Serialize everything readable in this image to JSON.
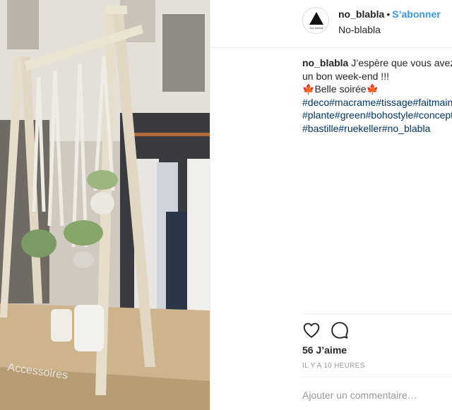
{
  "post": {
    "image_alt_name": "shop-window-photo"
  },
  "header": {
    "username": "no_blabla",
    "separator": "•",
    "follow_label": "S’abonner",
    "location": "No-blabla",
    "avatar_text": "No-blabla"
  },
  "caption": {
    "username": "no_blabla",
    "line1_text": "J’espère que vous avez",
    "line2_text": "un bon week-end !!!",
    "line3_text": "Belle soirée",
    "leaf_emoji": "🍁",
    "tags_line1": "#deco#macrame#tissage#faitmain",
    "tags_line2": "#plante#green#bohostyle#concept",
    "tags_line3": "#bastille#ruekeller#no_blabla"
  },
  "actions": {
    "like_icon": "heart-icon",
    "comment_icon": "comment-icon"
  },
  "likes_label": "56 J’aime",
  "timestamp": "IL Y A 10 HEURES",
  "comment_placeholder": "Ajouter un commentaire…",
  "colors": {
    "link_blue": "#3897f0",
    "hashtag": "#003569",
    "text": "#262626",
    "muted": "#999999"
  }
}
